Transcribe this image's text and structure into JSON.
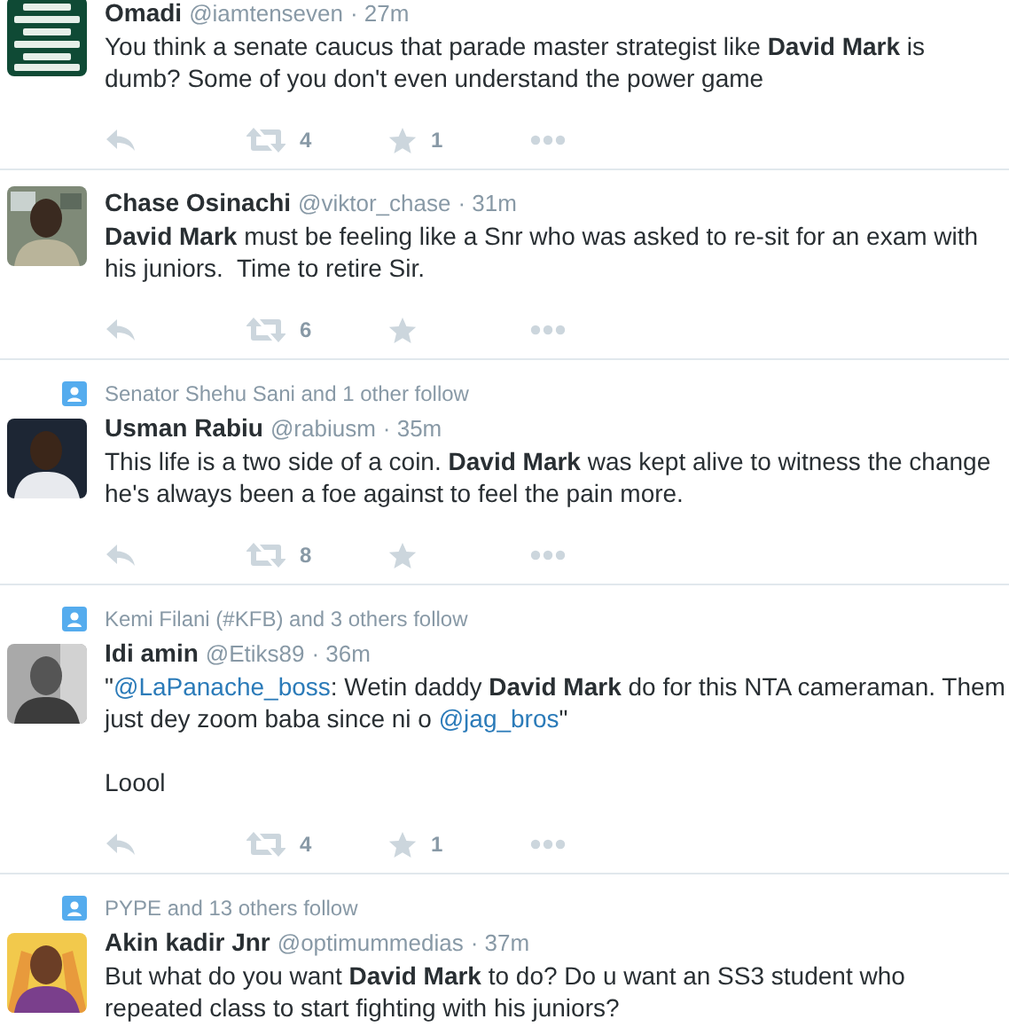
{
  "tweets": [
    {
      "avatar": {
        "kind": "picture"
      },
      "name": "Omadi",
      "handle": "@iamtenseven",
      "time": "· 27m",
      "paragraphs": [
        [
          {
            "kind": "text",
            "text": "You think a senate caucus that parade master strategist like **David Mark** is dumb? Some of you don't even understand the power game"
          }
        ]
      ],
      "retweets": "4",
      "favorites": "1"
    },
    {
      "avatar": {
        "kind": "picture"
      },
      "name": "Chase Osinachi",
      "handle": "@viktor_chase",
      "time": "· 31m",
      "paragraphs": [
        [
          {
            "kind": "text",
            "text": "**David Mark** must be feeling like a Snr who was asked to re-sit for an exam with his juniors.  Time to retire Sir."
          }
        ]
      ],
      "retweets": "6"
    },
    {
      "context": "Senator Shehu Sani and 1 other follow",
      "avatar": {
        "kind": "picture"
      },
      "name": "Usman Rabiu",
      "handle": "@rabiusm",
      "time": "· 35m",
      "paragraphs": [
        [
          {
            "kind": "text",
            "text": "This life is a two side of a coin. **David Mark** was kept alive to witness the change he's always been a foe against to feel the pain more."
          }
        ]
      ],
      "retweets": "8"
    },
    {
      "context": "Kemi Filani (#KFB) and 3 others follow",
      "avatar": {
        "kind": "picture"
      },
      "name": "Idi amin",
      "handle": "@Etiks89",
      "time": "· 36m",
      "paragraphs": [
        [
          {
            "kind": "text",
            "text": "\""
          },
          {
            "kind": "mention",
            "text": "@LaPanache_boss"
          },
          {
            "kind": "text",
            "text": ": Wetin daddy **David Mark** do for this NTA cameraman. Them just dey zoom baba since ni o "
          },
          {
            "kind": "mention",
            "text": "@jag_bros"
          },
          {
            "kind": "text",
            "text": "\""
          }
        ],
        [
          {
            "kind": "text",
            "text": "Loool"
          }
        ]
      ],
      "retweets": "4",
      "favorites": "1"
    },
    {
      "context": "PYPE and 13 others follow",
      "avatar": {
        "kind": "picture"
      },
      "name": "Akin kadir Jnr",
      "handle": "@optimummedias",
      "time": "· 37m",
      "paragraphs": [
        [
          {
            "kind": "text",
            "text": "But what do you want **David Mark** to do? Do u want an SS3 student who repeated class to start fighting with his juniors?"
          }
        ]
      ]
    }
  ]
}
